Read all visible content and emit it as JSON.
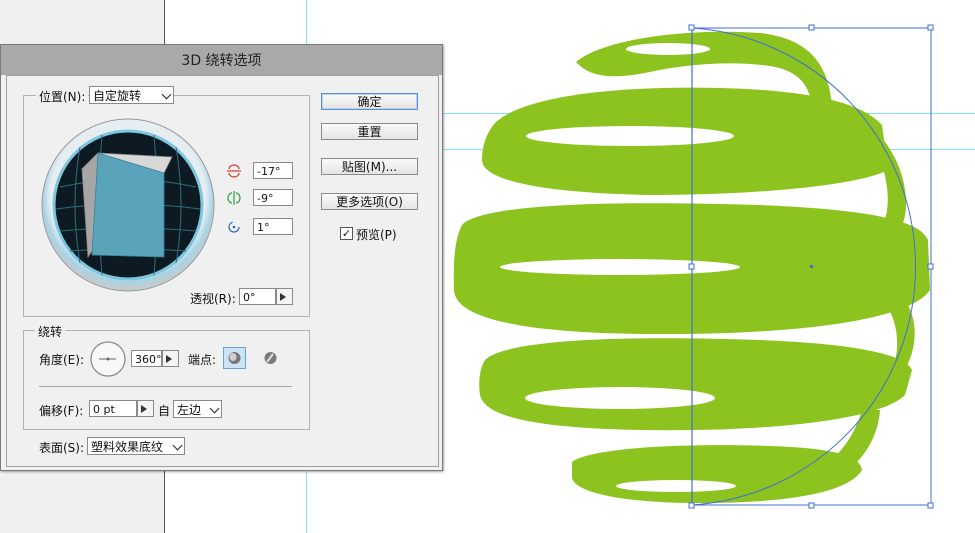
{
  "dialog": {
    "title": "3D 绕转选项",
    "position": {
      "label": "位置(N):",
      "value": "自定旋转",
      "rot_x": "-17°",
      "rot_y": "-9°",
      "rot_z": "1°",
      "perspective_label": "透视(R):",
      "perspective_value": "0°"
    },
    "revolve": {
      "group_label": "绕转",
      "angle_label": "角度(E):",
      "angle_value": "360°",
      "cap_label": "端点:",
      "offset_label": "偏移(F):",
      "offset_value": "0 pt",
      "from_label": "自",
      "from_value": "左边"
    },
    "surface": {
      "label": "表面(S):",
      "value": "塑料效果底纹"
    },
    "buttons": {
      "ok": "确定",
      "reset": "重置",
      "map": "贴图(M)...",
      "more": "更多选项(O)",
      "preview": "预览(P)"
    },
    "preview_checked": true
  },
  "colors": {
    "artwork_green": "#8cc31f",
    "selection_blue": "#3f6fd6",
    "guide_cyan": "#7fe5ee",
    "cube_face": "#5aa4bb",
    "cube_top": "#d8d8d8",
    "cube_side": "#a6a6a6"
  }
}
